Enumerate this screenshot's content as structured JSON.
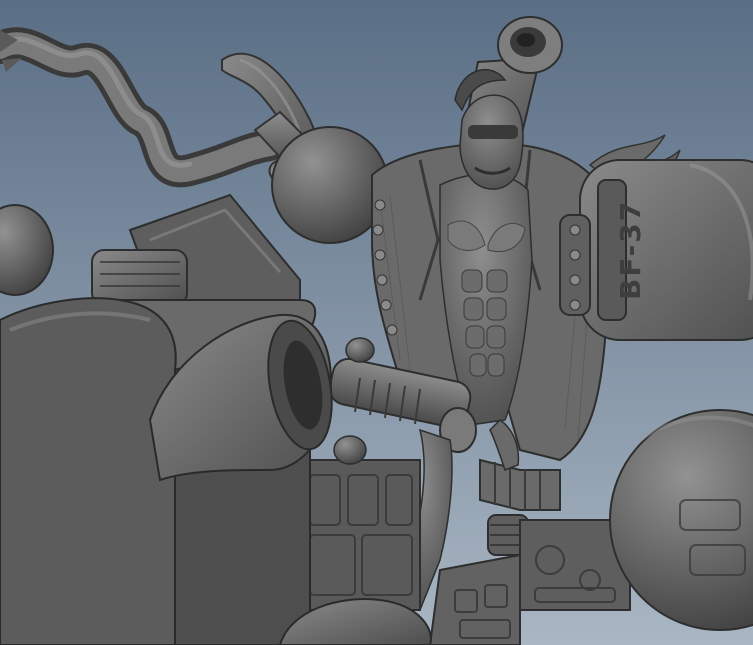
{
  "viewport": {
    "background_top": "#5a6e85",
    "background_bottom": "#a9b6c3",
    "model_color": "#6e6e6e",
    "model_shade": "#3e3e3e",
    "model_highlight": "#8a8a8a"
  },
  "model": {
    "cannon_marking": "BF-37"
  }
}
